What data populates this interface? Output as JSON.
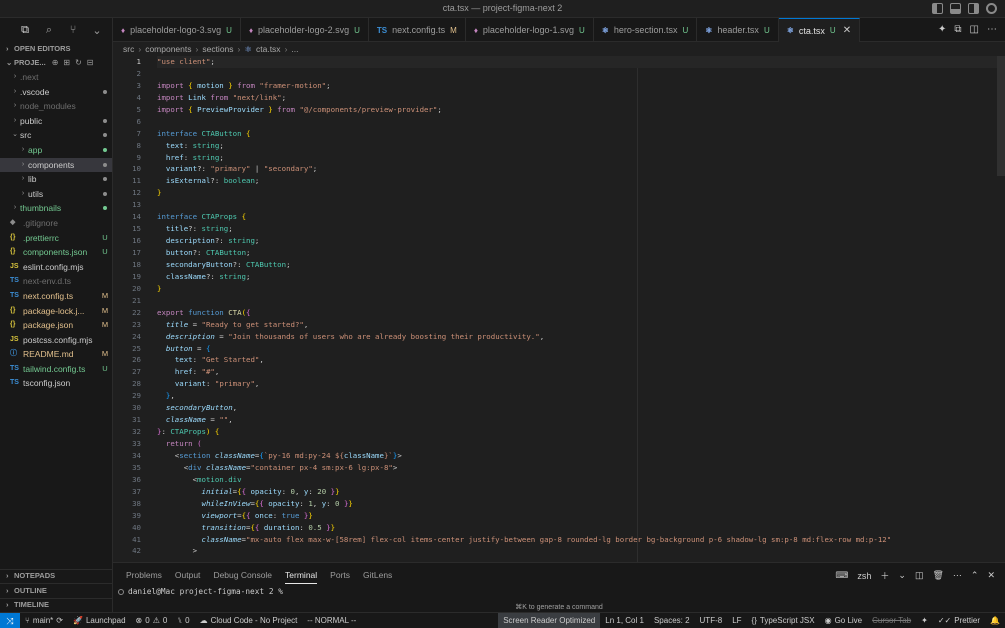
{
  "window": {
    "title": "cta.tsx — project-figma-next 2"
  },
  "sidebar": {
    "open_editors_label": "OPEN EDITORS",
    "project_label": "PROJE...",
    "tree": [
      {
        "label": ".next",
        "kind": "folder",
        "dim": true,
        "badge": "",
        "color": "gray",
        "selected": false,
        "indent": 0
      },
      {
        "label": ".vscode",
        "kind": "folder",
        "dim": false,
        "badge": "dot",
        "color": "normal",
        "selected": false,
        "indent": 0
      },
      {
        "label": "node_modules",
        "kind": "folder",
        "dim": true,
        "badge": "",
        "color": "gray",
        "selected": false,
        "indent": 0
      },
      {
        "label": "public",
        "kind": "folder",
        "dim": false,
        "badge": "dot",
        "color": "normal",
        "selected": false,
        "indent": 0
      },
      {
        "label": "src",
        "kind": "folder-open",
        "dim": false,
        "badge": "dot",
        "color": "normal",
        "selected": false,
        "indent": 0
      },
      {
        "label": "app",
        "kind": "folder",
        "dim": false,
        "badge": "dot",
        "color": "green",
        "selected": false,
        "indent": 1
      },
      {
        "label": "components",
        "kind": "folder",
        "dim": false,
        "badge": "dot",
        "color": "normal",
        "selected": true,
        "indent": 1
      },
      {
        "label": "lib",
        "kind": "folder",
        "dim": false,
        "badge": "dot",
        "color": "normal",
        "selected": false,
        "indent": 1
      },
      {
        "label": "utils",
        "kind": "folder",
        "dim": false,
        "badge": "dot",
        "color": "normal",
        "selected": false,
        "indent": 1
      },
      {
        "label": "thumbnails",
        "kind": "folder",
        "dim": false,
        "badge": "dot",
        "color": "green",
        "selected": false,
        "indent": 0
      },
      {
        "label": ".gitignore",
        "kind": "file",
        "icon": "◆",
        "dim": true,
        "badge": "",
        "color": "gray",
        "selected": false,
        "indent": 0
      },
      {
        "label": ".prettierrc",
        "kind": "file",
        "icon": "{}",
        "dim": false,
        "badge": "U",
        "color": "green",
        "selected": false,
        "indent": 0
      },
      {
        "label": "components.json",
        "kind": "file",
        "icon": "{}",
        "dim": false,
        "badge": "U",
        "color": "green",
        "selected": false,
        "indent": 0
      },
      {
        "label": "eslint.config.mjs",
        "kind": "file",
        "icon": "JS",
        "dim": false,
        "badge": "",
        "color": "normal",
        "selected": false,
        "indent": 0
      },
      {
        "label": "next-env.d.ts",
        "kind": "file",
        "icon": "TS",
        "dim": true,
        "badge": "",
        "color": "gray",
        "selected": false,
        "indent": 0
      },
      {
        "label": "next.config.ts",
        "kind": "file",
        "icon": "TS",
        "dim": false,
        "badge": "M",
        "color": "mod",
        "selected": false,
        "indent": 0
      },
      {
        "label": "package-lock.j...",
        "kind": "file",
        "icon": "{}",
        "dim": false,
        "badge": "M",
        "color": "mod",
        "selected": false,
        "indent": 0
      },
      {
        "label": "package.json",
        "kind": "file",
        "icon": "{}",
        "dim": false,
        "badge": "M",
        "color": "mod",
        "selected": false,
        "indent": 0
      },
      {
        "label": "postcss.config.mjs",
        "kind": "file",
        "icon": "JS",
        "dim": false,
        "badge": "",
        "color": "normal",
        "selected": false,
        "indent": 0
      },
      {
        "label": "README.md",
        "kind": "file",
        "icon": "ⓘ",
        "dim": false,
        "badge": "M",
        "color": "mod",
        "selected": false,
        "indent": 0
      },
      {
        "label": "tailwind.config.ts",
        "kind": "file",
        "icon": "TS",
        "dim": false,
        "badge": "U",
        "color": "green",
        "selected": false,
        "indent": 0
      },
      {
        "label": "tsconfig.json",
        "kind": "file",
        "icon": "TS",
        "dim": false,
        "badge": "",
        "color": "normal",
        "selected": false,
        "indent": 0
      }
    ],
    "bottom_sections": [
      "NOTEPADS",
      "OUTLINE",
      "TIMELINE"
    ]
  },
  "tabs": [
    {
      "label": "placeholder-logo-3.svg",
      "icon": "svg",
      "badge": "U",
      "color": "green",
      "active": false
    },
    {
      "label": "placeholder-logo-2.svg",
      "icon": "svg",
      "badge": "U",
      "color": "green",
      "active": false
    },
    {
      "label": "next.config.ts",
      "icon": "TS",
      "badge": "M",
      "color": "mod",
      "active": false
    },
    {
      "label": "placeholder-logo-1.svg",
      "icon": "svg",
      "badge": "U",
      "color": "green",
      "active": false
    },
    {
      "label": "hero-section.tsx",
      "icon": "react",
      "badge": "U",
      "color": "green",
      "active": false
    },
    {
      "label": "header.tsx",
      "icon": "react",
      "badge": "U",
      "color": "green",
      "active": false
    },
    {
      "label": "cta.tsx",
      "icon": "react",
      "badge": "U",
      "color": "green",
      "active": true
    }
  ],
  "breadcrumb": [
    "src",
    "components",
    "sections",
    "cta.tsx",
    "..."
  ],
  "editor": {
    "current_line": 1,
    "line_count": 42
  },
  "panel": {
    "tabs": [
      "Problems",
      "Output",
      "Debug Console",
      "Terminal",
      "Ports",
      "GitLens"
    ],
    "active_tab": "Terminal",
    "shell": "zsh",
    "prompt": "daniel@Mac project-figma-next 2 %",
    "hint": "⌘K to generate a command"
  },
  "statusbar": {
    "branch": "main*",
    "launchpad": "Launchpad",
    "errors": "0",
    "warnings": "0",
    "ports": "0",
    "cloud": "Cloud Code - No Project",
    "mode": "-- NORMAL --",
    "screen_reader": "Screen Reader Optimized",
    "position": "Ln 1, Col 1",
    "spaces": "Spaces: 2",
    "encoding": "UTF-8",
    "eol": "LF",
    "language": "TypeScript JSX",
    "golive": "Go Live",
    "cursor_tab": "Cursor Tab",
    "prettier": "Prettier"
  }
}
